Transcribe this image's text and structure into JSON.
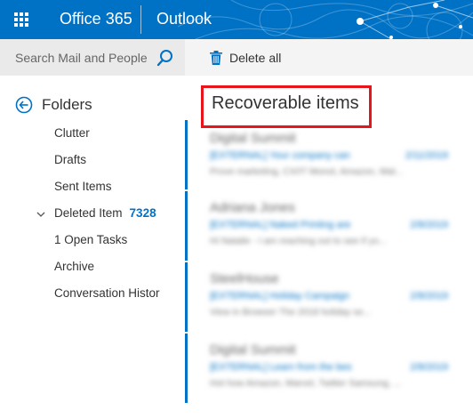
{
  "header": {
    "brand": "Office 365",
    "app": "Outlook"
  },
  "search": {
    "placeholder": "Search Mail and People"
  },
  "commands": {
    "delete_all": "Delete all"
  },
  "folders": {
    "title": "Folders",
    "items": [
      {
        "label": "Clutter"
      },
      {
        "label": "Drafts"
      },
      {
        "label": "Sent Items"
      },
      {
        "label": "Deleted Item",
        "count": "7328"
      },
      {
        "label": "1 Open Tasks"
      },
      {
        "label": "Archive"
      },
      {
        "label": "Conversation Histor"
      }
    ]
  },
  "list": {
    "title": "Recoverable items",
    "messages": [
      {
        "from": "Digital Summit",
        "subject": "[EXTERNAL] Your company can",
        "date": "2/11/2019",
        "preview": "Prove marketing, CX/IT Monot, Amazon, Wal..."
      },
      {
        "from": "Adriana Jones",
        "subject": "[EXTERNAL] Naked Printing are",
        "date": "2/8/2019",
        "preview": "Hi Natalie - I am reaching out to see if yo..."
      },
      {
        "from": "SteelHouse",
        "subject": "[EXTERNAL] Holiday Campaign",
        "date": "2/8/2019",
        "preview": "View in Browser       The 2018 holiday se..."
      },
      {
        "from": "Digital Summit",
        "subject": "[EXTERNAL] Learn from the bes",
        "date": "2/8/2019",
        "preview": "Hot how Amazon, Marvel, Twitter Samsung, ..."
      }
    ]
  },
  "colors": {
    "brand_blue": "#0072c6",
    "highlight_red": "#e8141c"
  }
}
